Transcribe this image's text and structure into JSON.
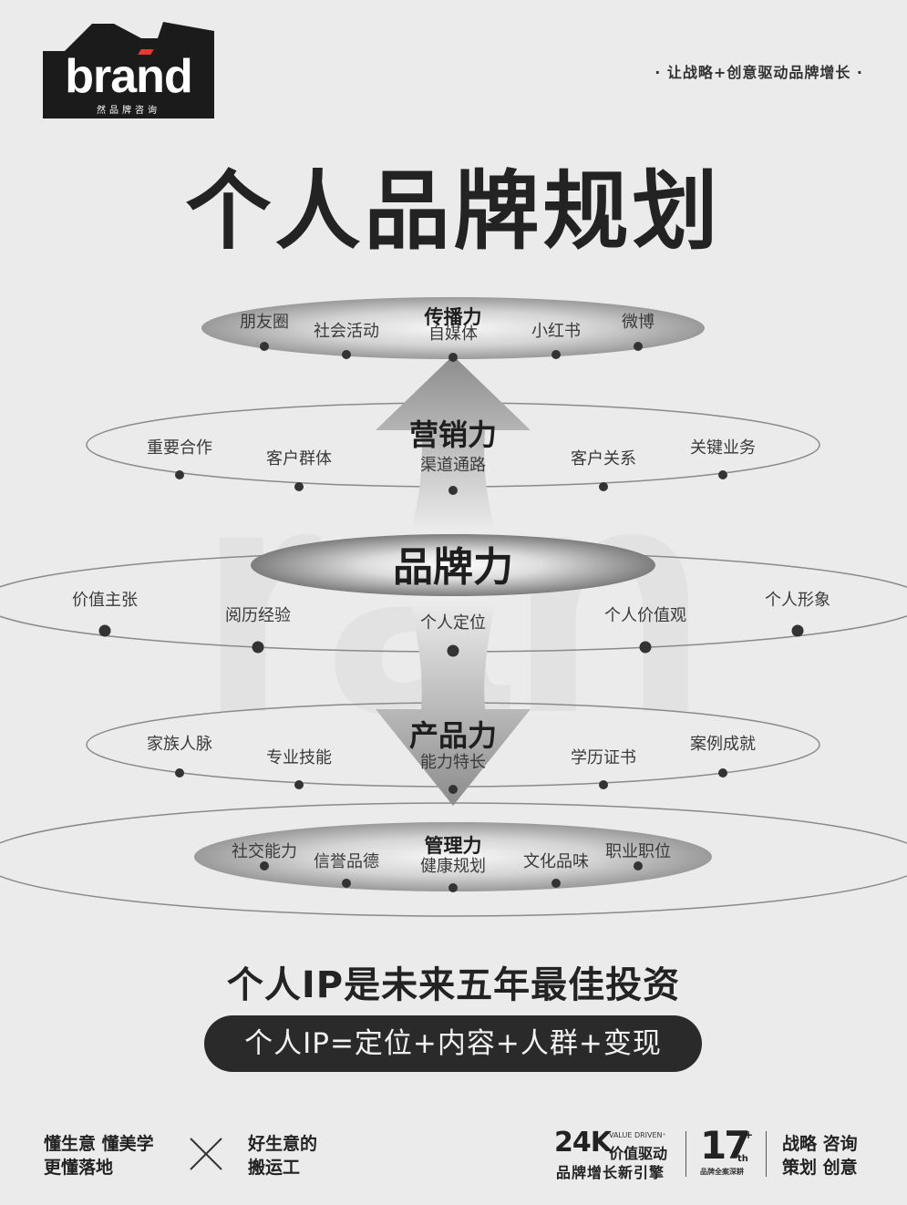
{
  "brand": {
    "logo_text": "brand",
    "logo_sub": "然品牌咨询"
  },
  "slogan": "· 让战略+创意驱动品牌增长 ·",
  "title": "个人品牌规划",
  "diagram": {
    "watermark": "ran",
    "layers": [
      {
        "title": "传播力",
        "items": [
          "朋友圈",
          "社会活动",
          "自媒体",
          "小红书",
          "微博"
        ]
      },
      {
        "title": "营销力",
        "items": [
          "重要合作",
          "客户群体",
          "渠道通路",
          "客户关系",
          "关键业务"
        ]
      },
      {
        "title": "品牌力",
        "items": [
          "价值主张",
          "阅历经验",
          "个人定位",
          "个人价值观",
          "个人形象"
        ]
      },
      {
        "title": "产品力",
        "items": [
          "家族人脉",
          "专业技能",
          "能力特长",
          "学历证书",
          "案例成就"
        ]
      },
      {
        "title": "管理力",
        "items": [
          "社交能力",
          "信誉品德",
          "健康规划",
          "文化品味",
          "职业职位"
        ]
      }
    ]
  },
  "headline": "个人IP是未来五年最佳投资",
  "formula": "个人IP=定位+内容+人群+变现",
  "footer": {
    "left": [
      "懂生意 懂美学",
      "更懂落地"
    ],
    "middle": [
      "好生意的",
      "搬运工"
    ],
    "stat1": {
      "value": "24K",
      "tag": "VALUE DRIVEN⁺",
      "line1": "价值驱动",
      "line2": "品牌增长新引擎"
    },
    "stat2": {
      "value": "17",
      "plus": "+",
      "suffix": "th",
      "caption": "品牌全案深耕"
    },
    "right": [
      "战略 咨询",
      "策划 创意"
    ]
  }
}
